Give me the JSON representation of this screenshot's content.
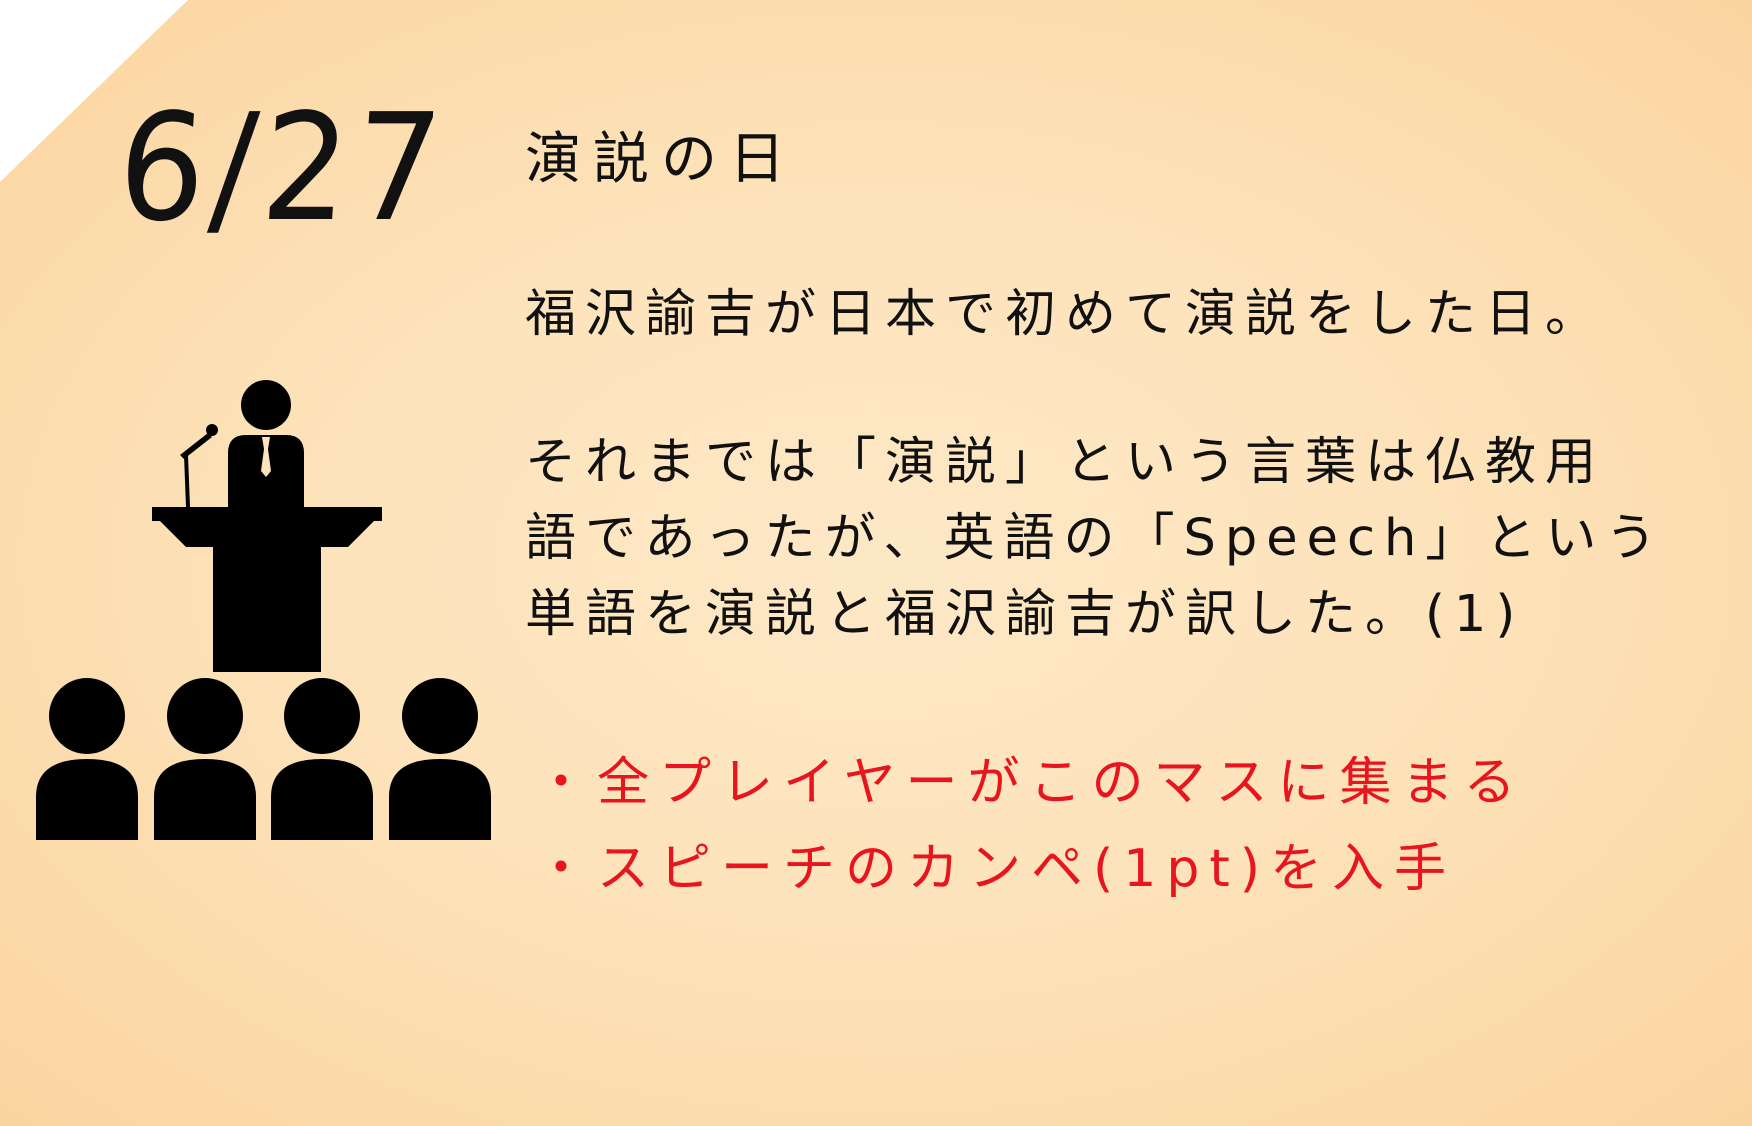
{
  "date": "6/27",
  "title": "演説の日",
  "description": {
    "line1": "福沢諭吉が日本で初めて演説をした日。",
    "paragraph": [
      "それまでは「演説」という言葉は仏教用",
      "語であったが、英語の「Speech」という",
      "単語を演説と福沢諭吉が訳した。(1)"
    ]
  },
  "rules": [
    "・全プレイヤーがこのマスに集まる",
    "・スピーチのカンペ(1pt)を入手"
  ],
  "icon": "speaker-at-podium-with-audience-icon",
  "colors": {
    "background": "#fde3bb",
    "text": "#111111",
    "rule_text": "#e8141e"
  }
}
